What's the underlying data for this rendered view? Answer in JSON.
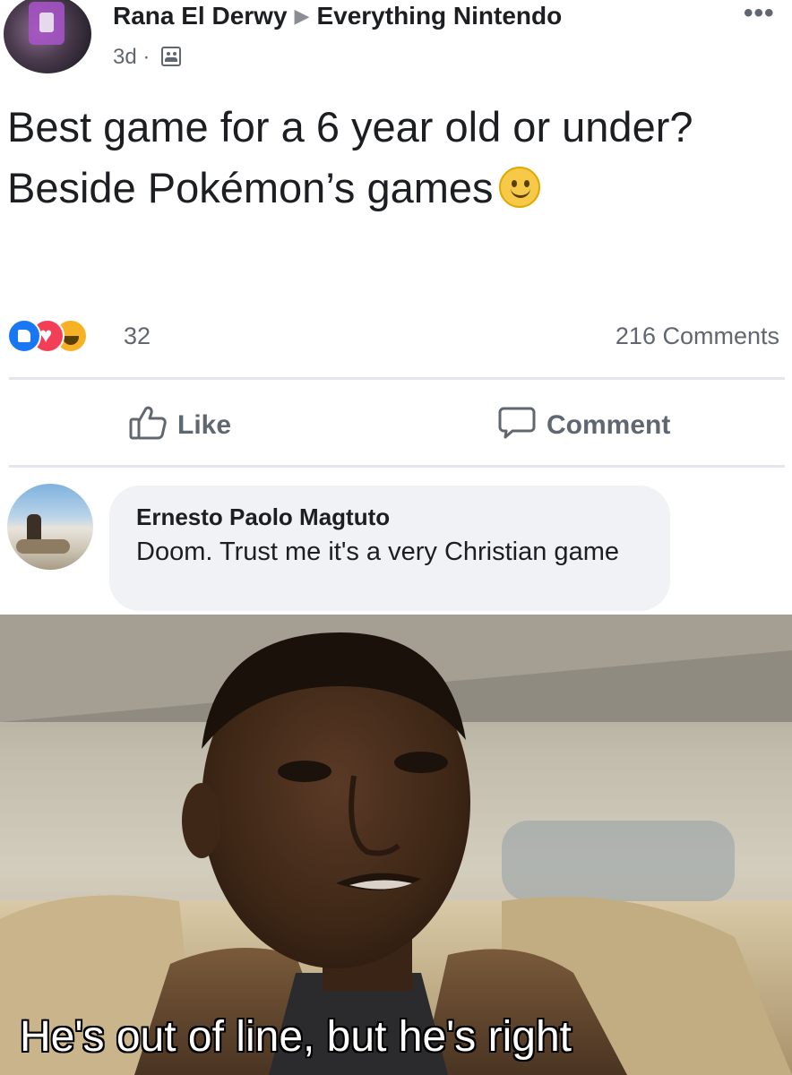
{
  "post": {
    "author": "Rana El Derwy",
    "group": "Everything Nintendo",
    "time": "3d",
    "separator": "·",
    "more_label": "•••",
    "text_line1": "Best game for a 6 year old or under?",
    "text_line2": "Beside Pokémon’s games",
    "reaction_icons": [
      "like-icon",
      "love-icon",
      "haha-icon"
    ],
    "reaction_count": "32",
    "comments_count": "216 Comments",
    "like_label": "Like",
    "comment_label": "Comment"
  },
  "comment": {
    "author": "Ernesto Paolo Magtuto",
    "text": "Doom. Trust me it's a very Christian game"
  },
  "meme": {
    "caption": "He's out of line, but he's right"
  },
  "colors": {
    "like_blue": "#1877f2",
    "love_red": "#f33e58",
    "haha_yellow": "#f7b125",
    "secondary_text": "#606770",
    "bubble_bg": "#f0f2f5"
  }
}
